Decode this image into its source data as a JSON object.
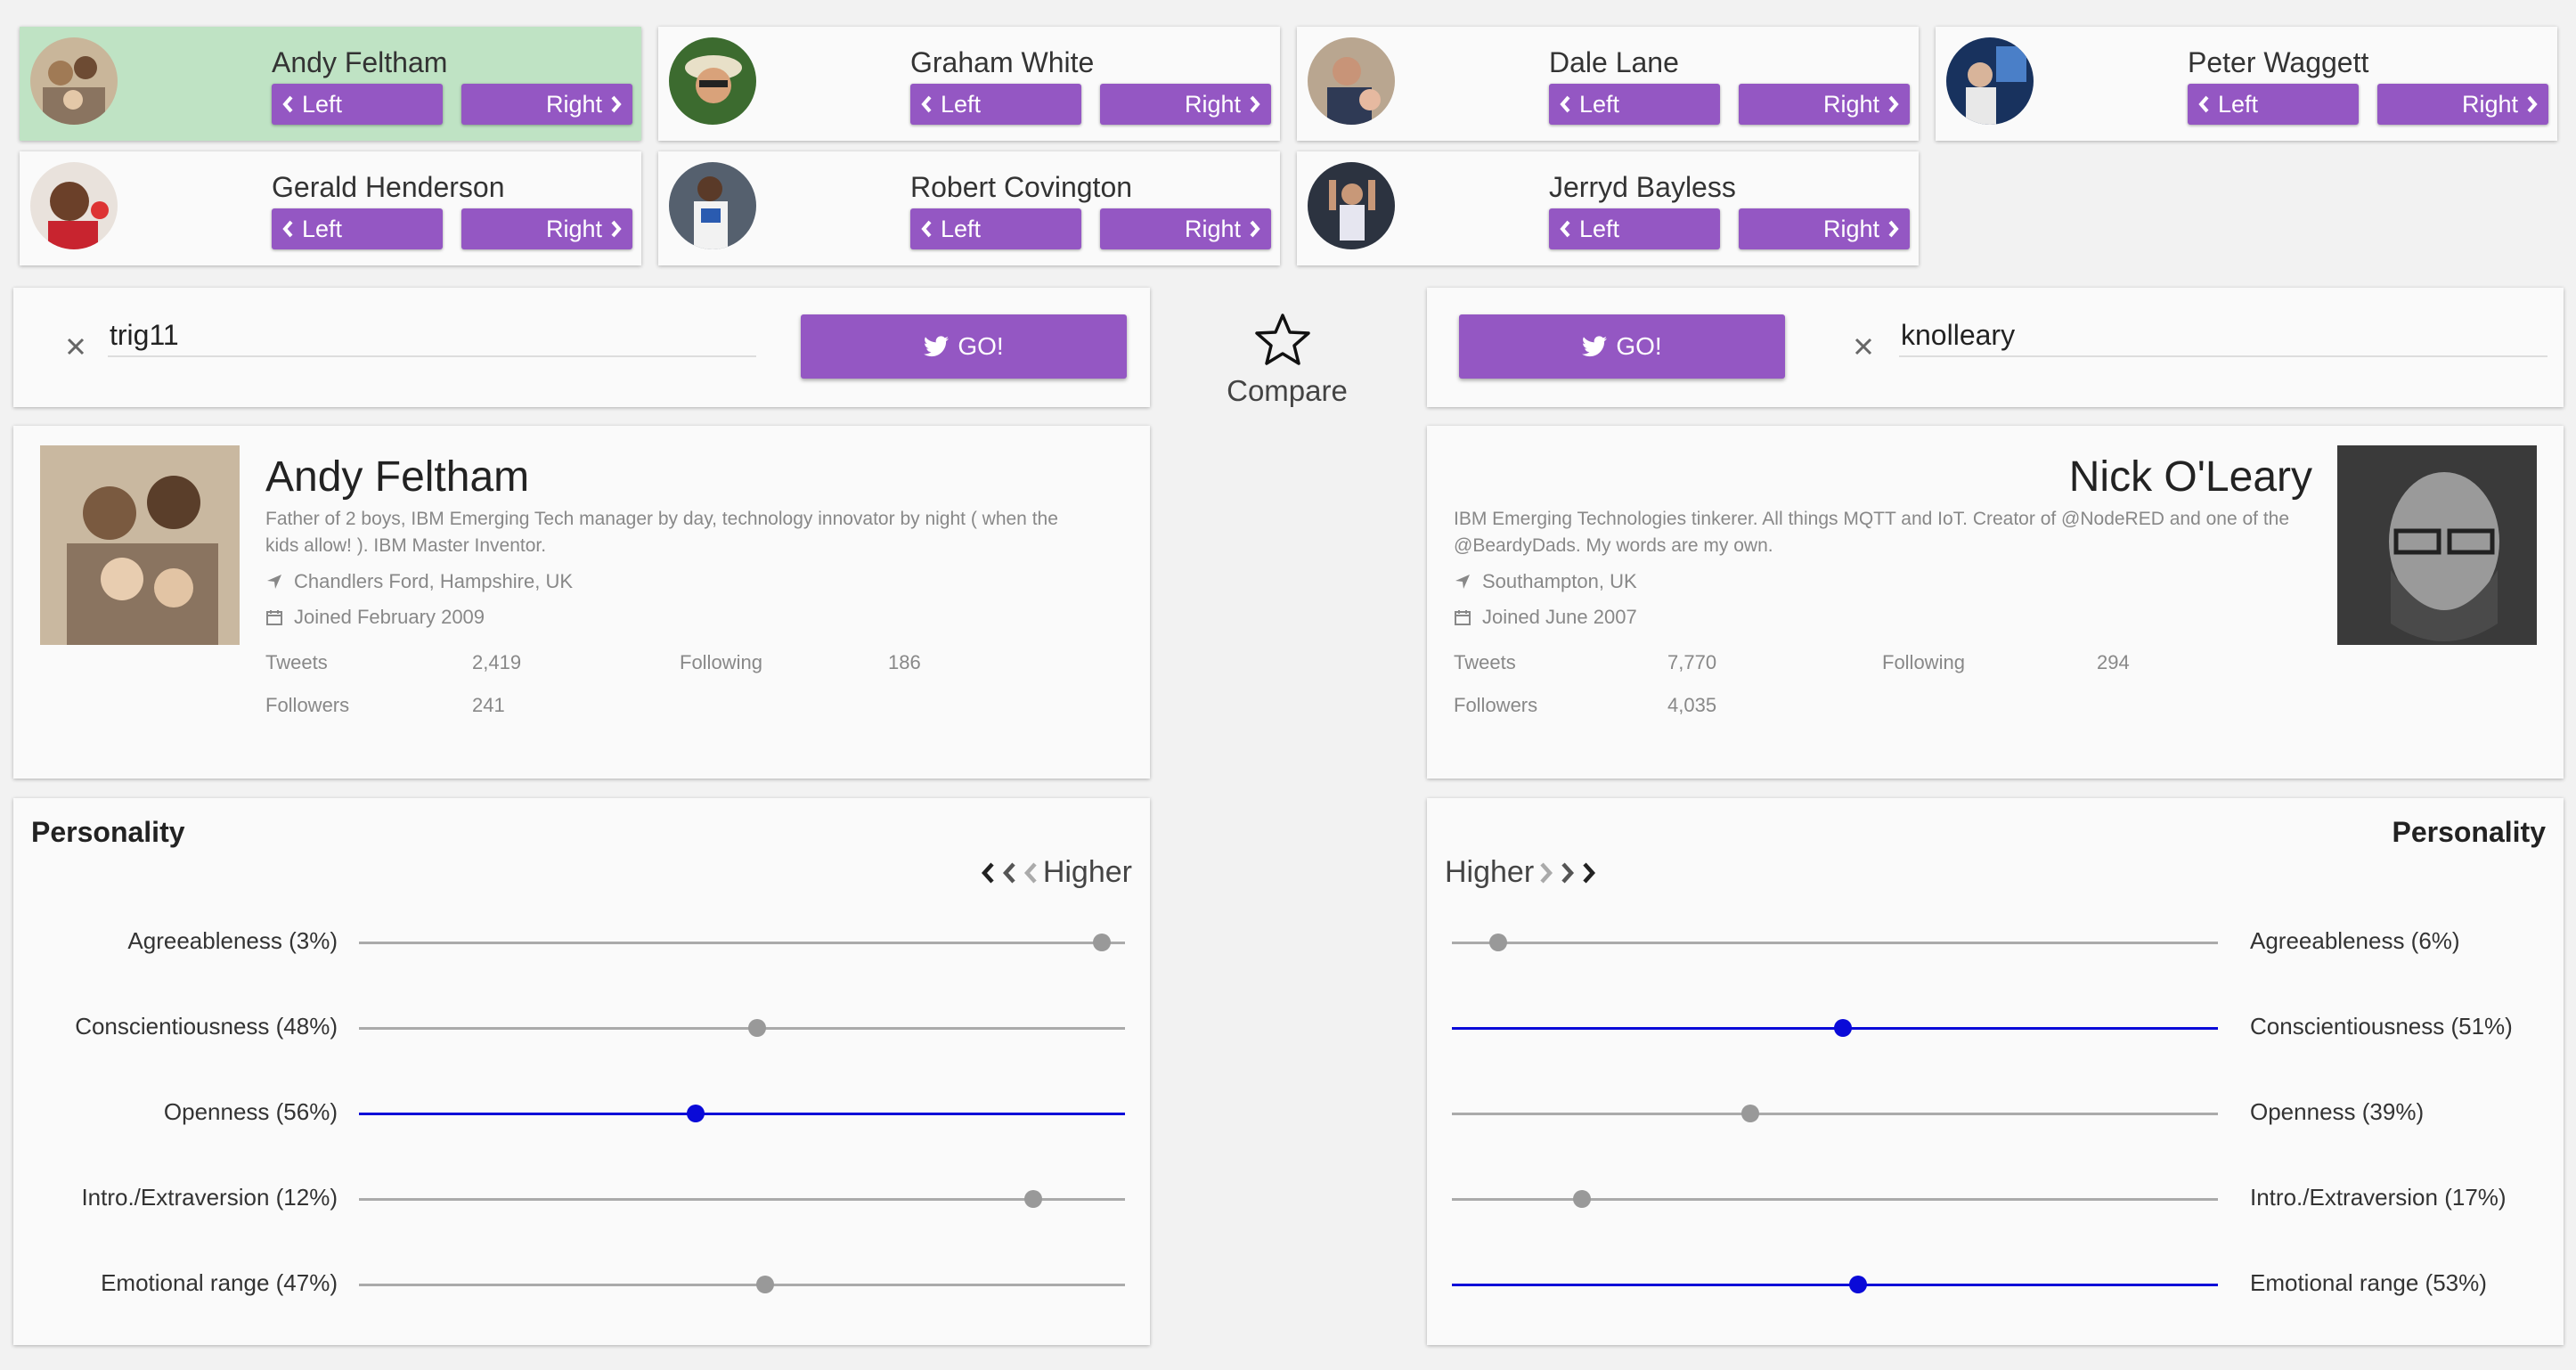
{
  "people": [
    {
      "name": "Andy Feltham",
      "left": "Left",
      "right": "Right",
      "selected": true
    },
    {
      "name": "Graham White",
      "left": "Left",
      "right": "Right"
    },
    {
      "name": "Dale Lane",
      "left": "Left",
      "right": "Right"
    },
    {
      "name": "Peter Waggett",
      "left": "Left",
      "right": "Right"
    },
    {
      "name": "Gerald Henderson",
      "left": "Left",
      "right": "Right"
    },
    {
      "name": "Robert Covington",
      "left": "Left",
      "right": "Right"
    },
    {
      "name": "Jerryd Bayless",
      "left": "Left",
      "right": "Right"
    }
  ],
  "left_search": {
    "value": "trig11",
    "go_label": "GO!"
  },
  "right_search": {
    "value": "knolleary",
    "go_label": "GO!"
  },
  "compare": {
    "label": "Compare"
  },
  "left_profile": {
    "name": "Andy Feltham",
    "bio": "Father of 2 boys, IBM Emerging Tech manager by day, technology innovator by night ( when the kids allow! ). IBM Master Inventor.",
    "location": "Chandlers Ford, Hampshire, UK",
    "joined": "Joined February 2009",
    "tweets_label": "Tweets",
    "tweets": "2,419",
    "following_label": "Following",
    "following": "186",
    "followers_label": "Followers",
    "followers": "241"
  },
  "right_profile": {
    "name": "Nick O'Leary",
    "bio": "IBM Emerging Technologies tinkerer. All things MQTT and IoT. Creator of @NodeRED and one of the @BeardyDads. My words are my own.",
    "location": "Southampton, UK",
    "joined": "Joined June 2007",
    "tweets_label": "Tweets",
    "tweets": "7,770",
    "following_label": "Following",
    "following": "294",
    "followers_label": "Followers",
    "followers": "4,035"
  },
  "left_personality": {
    "title": "Personality",
    "higher_label": "Higher",
    "traits": [
      {
        "label": "Agreeableness (3%)",
        "value": 3,
        "active": false
      },
      {
        "label": "Conscientiousness (48%)",
        "value": 48,
        "active": false
      },
      {
        "label": "Openness (56%)",
        "value": 56,
        "active": true
      },
      {
        "label": "Intro./Extraversion (12%)",
        "value": 12,
        "active": false
      },
      {
        "label": "Emotional range (47%)",
        "value": 47,
        "active": false
      }
    ]
  },
  "right_personality": {
    "title": "Personality",
    "higher_label": "Higher",
    "traits": [
      {
        "label": "Agreeableness (6%)",
        "value": 6,
        "active": false
      },
      {
        "label": "Conscientiousness (51%)",
        "value": 51,
        "active": true
      },
      {
        "label": "Openness (39%)",
        "value": 39,
        "active": false
      },
      {
        "label": "Intro./Extraversion (17%)",
        "value": 17,
        "active": false
      },
      {
        "label": "Emotional range (53%)",
        "value": 53,
        "active": true
      }
    ]
  },
  "colors": {
    "accent": "#9457c3",
    "selected": "#bfe3c4",
    "active_slider": "#0a0ad8",
    "inactive_slider": "#aaaaaa"
  }
}
